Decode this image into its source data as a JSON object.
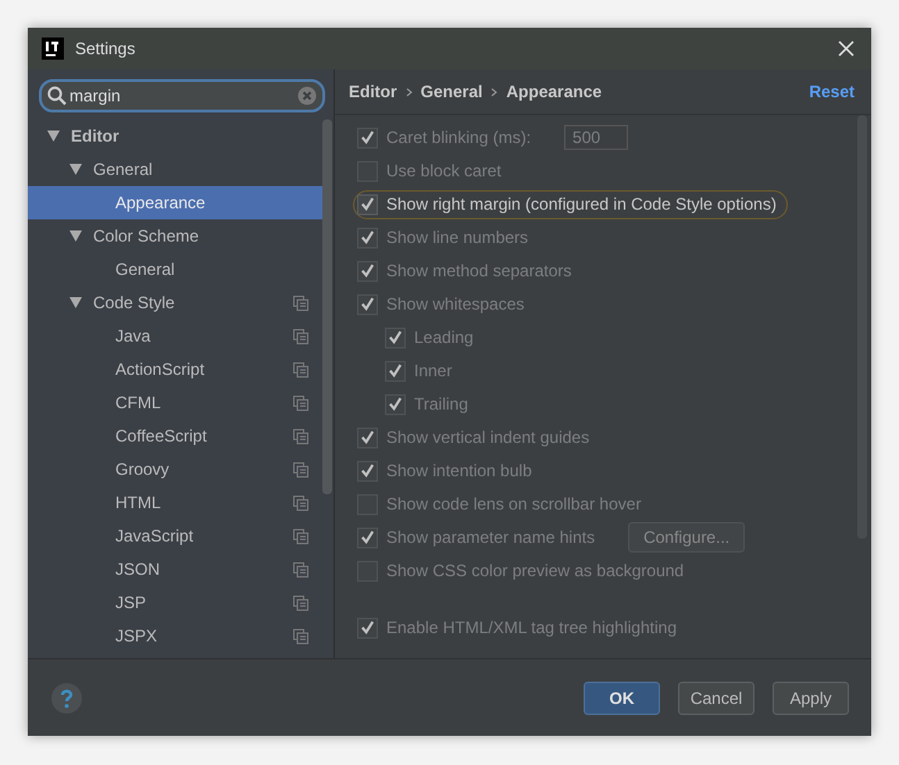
{
  "window": {
    "title": "Settings"
  },
  "search": {
    "value": "margin"
  },
  "tree": [
    {
      "label": "Editor",
      "bold": true,
      "expanded": true,
      "selected": false,
      "copy_icon": false,
      "children": [
        {
          "label": "General",
          "bold": false,
          "expanded": true,
          "selected": false,
          "copy_icon": false,
          "children": [
            {
              "label": "Appearance",
              "bold": false,
              "selected": true,
              "copy_icon": false
            }
          ]
        },
        {
          "label": "Color Scheme",
          "bold": false,
          "expanded": true,
          "selected": false,
          "copy_icon": false,
          "children": [
            {
              "label": "General",
              "bold": false,
              "selected": false,
              "copy_icon": false
            }
          ]
        },
        {
          "label": "Code Style",
          "bold": false,
          "expanded": true,
          "selected": false,
          "copy_icon": true,
          "children": [
            {
              "label": "Java",
              "bold": false,
              "selected": false,
              "copy_icon": true
            },
            {
              "label": "ActionScript",
              "bold": false,
              "selected": false,
              "copy_icon": true
            },
            {
              "label": "CFML",
              "bold": false,
              "selected": false,
              "copy_icon": true
            },
            {
              "label": "CoffeeScript",
              "bold": false,
              "selected": false,
              "copy_icon": true
            },
            {
              "label": "Groovy",
              "bold": false,
              "selected": false,
              "copy_icon": true
            },
            {
              "label": "HTML",
              "bold": false,
              "selected": false,
              "copy_icon": true
            },
            {
              "label": "JavaScript",
              "bold": false,
              "selected": false,
              "copy_icon": true
            },
            {
              "label": "JSON",
              "bold": false,
              "selected": false,
              "copy_icon": true
            },
            {
              "label": "JSP",
              "bold": false,
              "selected": false,
              "copy_icon": true
            },
            {
              "label": "JSPX",
              "bold": false,
              "selected": false,
              "copy_icon": true
            }
          ]
        }
      ]
    }
  ],
  "breadcrumb": [
    "Editor",
    "General",
    "Appearance"
  ],
  "reset": "Reset",
  "option_groups": [
    [
      {
        "label": "Caret blinking (ms):",
        "checked": true,
        "matched": false,
        "field_value": "500"
      },
      {
        "label": "Use block caret",
        "checked": false,
        "matched": false
      },
      {
        "label": "Show right margin (configured in Code Style options)",
        "checked": true,
        "matched": true
      },
      {
        "label": "Show line numbers",
        "checked": true,
        "matched": false
      },
      {
        "label": "Show method separators",
        "checked": true,
        "matched": false
      },
      {
        "label": "Show whitespaces",
        "checked": true,
        "matched": false,
        "children": [
          {
            "label": "Leading",
            "checked": true,
            "matched": false
          },
          {
            "label": "Inner",
            "checked": true,
            "matched": false
          },
          {
            "label": "Trailing",
            "checked": true,
            "matched": false
          }
        ]
      },
      {
        "label": "Show vertical indent guides",
        "checked": true,
        "matched": false
      },
      {
        "label": "Show intention bulb",
        "checked": true,
        "matched": false
      },
      {
        "label": "Show code lens on scrollbar hover",
        "checked": false,
        "matched": false
      },
      {
        "label": "Show parameter name hints",
        "checked": true,
        "matched": false,
        "button": "Configure..."
      },
      {
        "label": "Show CSS color preview as background",
        "checked": false,
        "matched": false
      }
    ],
    [
      {
        "label": "Enable HTML/XML tag tree highlighting",
        "checked": true,
        "matched": false
      }
    ]
  ],
  "buttons": [
    {
      "label": "OK",
      "default": true
    },
    {
      "label": "Cancel",
      "default": false
    },
    {
      "label": "Apply",
      "default": false
    }
  ]
}
